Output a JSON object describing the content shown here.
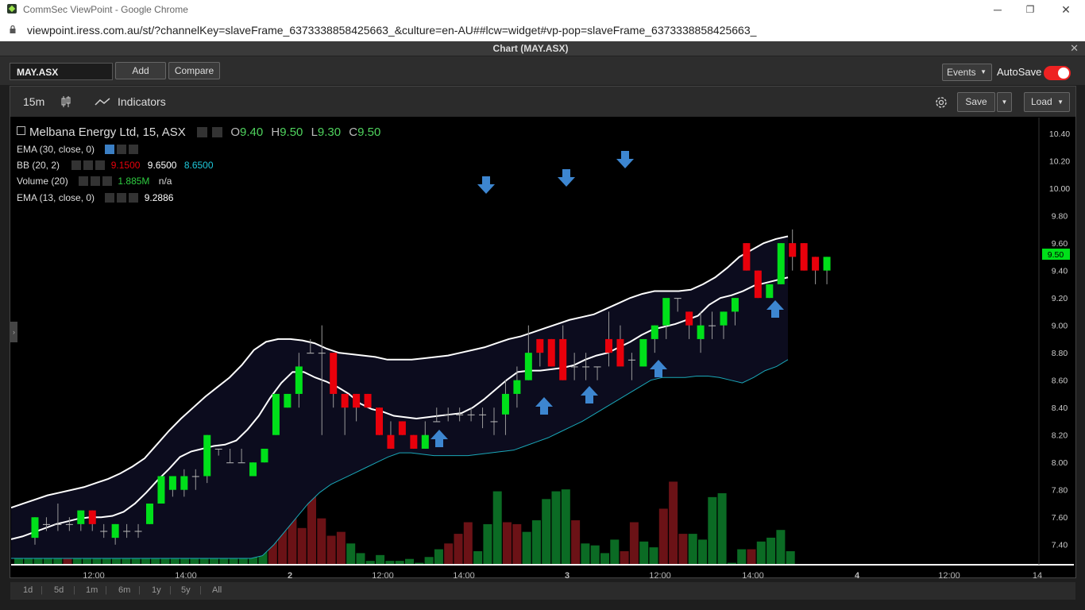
{
  "window": {
    "title": "CommSec ViewPoint - Google Chrome",
    "url": "viewpoint.iress.com.au/st/?channelKey=slaveFrame_6373338858425663_&culture=en-AU##lcw=widget#vp-pop=slaveFrame_6373338858425663_",
    "minimize": "─",
    "restore": "❐",
    "close": "✕"
  },
  "panel": {
    "title": "Chart (MAY.ASX)",
    "close": "✕"
  },
  "toolbar": {
    "symbol": "MAY.ASX",
    "add": "Add",
    "compare": "Compare",
    "events": "Events",
    "autosave": "AutoSave"
  },
  "chart_toolbar": {
    "interval": "15m",
    "indicators": "Indicators",
    "save": "Save",
    "load": "Load"
  },
  "legend": {
    "main": "Melbana Energy Ltd, 15, ASX",
    "o_label": "O",
    "o": "9.40",
    "h_label": "H",
    "h": "9.50",
    "l_label": "L",
    "l": "9.30",
    "c_label": "C",
    "c": "9.50",
    "ema30": "EMA (30, close, 0)",
    "bb": "BB (20, 2)",
    "bb_v1": "9.1500",
    "bb_v2": "9.6500",
    "bb_v3": "8.6500",
    "vol": "Volume (20)",
    "vol_v1": "1.885M",
    "vol_v2": "n/a",
    "ema13": "EMA (13, close, 0)",
    "ema13_v": "9.2886"
  },
  "range_buttons": [
    "1d",
    "5d",
    "1m",
    "6m",
    "1y",
    "5y",
    "All"
  ],
  "colors": {
    "up": "#00e01a",
    "down": "#e8000b",
    "vol_up": "#0b6b24",
    "vol_down": "#6b1216",
    "ema": "#ffffff",
    "bb_lower": "#1aa7b8",
    "price_tag": "#00e01a",
    "arrow": "#3d86d0"
  },
  "chart_data": {
    "type": "candlestick",
    "y_ticks": [
      10.4,
      10.2,
      10.0,
      9.8,
      9.6,
      9.4,
      9.2,
      9.0,
      8.8,
      8.6,
      8.4,
      8.2,
      8.0,
      7.8,
      7.6,
      7.4
    ],
    "ylim": [
      7.3,
      10.47
    ],
    "x_ticks": [
      "12:00",
      "14:00",
      "2",
      "12:00",
      "14:00",
      "3",
      "12:00",
      "14:00",
      "4",
      "12:00",
      "14"
    ],
    "last_price": "9.50",
    "candles": [
      [
        7.45,
        7.6,
        7.4,
        7.6
      ],
      [
        7.55,
        7.6,
        7.5,
        7.55
      ],
      [
        7.55,
        7.7,
        7.5,
        7.55
      ],
      [
        7.55,
        7.6,
        7.5,
        7.55
      ],
      [
        7.55,
        7.65,
        7.5,
        7.65
      ],
      [
        7.65,
        7.65,
        7.5,
        7.55
      ],
      [
        7.5,
        7.55,
        7.45,
        7.5
      ],
      [
        7.45,
        7.55,
        7.4,
        7.55
      ],
      [
        7.5,
        7.55,
        7.45,
        7.5
      ],
      [
        7.5,
        7.55,
        7.45,
        7.5
      ],
      [
        7.55,
        7.7,
        7.55,
        7.7
      ],
      [
        7.7,
        7.9,
        7.7,
        7.9
      ],
      [
        7.8,
        7.9,
        7.75,
        7.9
      ],
      [
        7.8,
        7.95,
        7.75,
        7.9
      ],
      [
        7.9,
        7.95,
        7.8,
        7.9
      ],
      [
        7.9,
        8.2,
        7.85,
        8.2
      ],
      [
        8.1,
        8.1,
        8.05,
        8.1
      ],
      [
        8.0,
        8.1,
        8.0,
        8.0
      ],
      [
        8.0,
        8.1,
        8.0,
        8.0
      ],
      [
        7.9,
        8.0,
        7.9,
        8.0
      ],
      [
        8.0,
        8.1,
        8.0,
        8.1
      ],
      [
        8.2,
        8.5,
        8.2,
        8.5
      ],
      [
        8.4,
        8.5,
        8.4,
        8.5
      ],
      [
        8.5,
        8.8,
        8.4,
        8.7
      ],
      [
        8.8,
        8.9,
        8.8,
        8.8
      ],
      [
        8.8,
        9.0,
        8.2,
        8.8
      ],
      [
        8.8,
        8.8,
        8.4,
        8.5
      ],
      [
        8.5,
        8.5,
        8.2,
        8.4
      ],
      [
        8.5,
        8.5,
        8.3,
        8.4
      ],
      [
        8.5,
        8.5,
        8.4,
        8.4
      ],
      [
        8.4,
        8.4,
        8.2,
        8.2
      ],
      [
        8.2,
        8.3,
        8.1,
        8.1
      ],
      [
        8.3,
        8.3,
        8.2,
        8.2
      ],
      [
        8.2,
        8.2,
        8.1,
        8.1
      ],
      [
        8.1,
        8.3,
        8.1,
        8.2
      ],
      [
        8.3,
        8.4,
        8.3,
        8.3
      ],
      [
        8.35,
        8.4,
        8.3,
        8.35
      ],
      [
        8.35,
        8.4,
        8.3,
        8.35
      ],
      [
        8.35,
        8.4,
        8.3,
        8.35
      ],
      [
        8.35,
        8.4,
        8.25,
        8.35
      ],
      [
        8.3,
        8.4,
        8.2,
        8.3
      ],
      [
        8.35,
        8.6,
        8.2,
        8.5
      ],
      [
        8.5,
        8.7,
        8.4,
        8.6
      ],
      [
        8.6,
        9.0,
        8.6,
        8.8
      ],
      [
        8.9,
        8.9,
        8.7,
        8.8
      ],
      [
        8.9,
        8.9,
        8.7,
        8.7
      ],
      [
        8.9,
        9.0,
        8.6,
        8.6
      ],
      [
        8.7,
        8.8,
        8.6,
        8.7
      ],
      [
        8.7,
        8.8,
        8.6,
        8.7
      ],
      [
        8.7,
        8.7,
        8.6,
        8.7
      ],
      [
        8.9,
        9.1,
        8.7,
        8.8
      ],
      [
        8.9,
        9.0,
        8.8,
        8.7
      ],
      [
        8.75,
        8.8,
        8.6,
        8.75
      ],
      [
        8.7,
        8.9,
        8.7,
        8.9
      ],
      [
        8.9,
        9.0,
        8.8,
        9.0
      ],
      [
        9.0,
        9.1,
        8.9,
        9.2
      ],
      [
        9.2,
        9.2,
        9.1,
        9.2
      ],
      [
        9.1,
        9.1,
        8.9,
        9.0
      ],
      [
        8.9,
        9.1,
        8.8,
        9.0
      ],
      [
        9.0,
        9.1,
        8.9,
        9.0
      ],
      [
        9.0,
        9.1,
        8.9,
        9.1
      ],
      [
        9.1,
        9.2,
        9.0,
        9.2
      ],
      [
        9.6,
        9.6,
        9.4,
        9.4
      ],
      [
        9.4,
        9.4,
        9.2,
        9.2
      ],
      [
        9.2,
        9.3,
        9.2,
        9.3
      ],
      [
        9.3,
        9.6,
        9.3,
        9.6
      ],
      [
        9.6,
        9.7,
        9.4,
        9.5
      ],
      [
        9.6,
        9.6,
        9.4,
        9.4
      ],
      [
        9.5,
        9.5,
        9.3,
        9.4
      ],
      [
        9.4,
        9.5,
        9.3,
        9.5
      ]
    ],
    "volume_rel": [
      0.21,
      0.27,
      0.13,
      0.08,
      0.09,
      0.06,
      0.05,
      0.04,
      0.04,
      0.06,
      0.08,
      0.16,
      0.41,
      0.35,
      0.19,
      0.2,
      0.5,
      0.05,
      0.04,
      0.04,
      0.06,
      0.06,
      0.11,
      0.27,
      0.35,
      0.52,
      0.41,
      0.31,
      0.74,
      0.19,
      0.4,
      0.24,
      0.15,
      0.17,
      0.11,
      0.06,
      0.02,
      0.05,
      0.02,
      0.02,
      0.03,
      0.01,
      0.04,
      0.08,
      0.11,
      0.16,
      0.22,
      0.07,
      0.21,
      0.38,
      0.22,
      0.21,
      0.17,
      0.23,
      0.34,
      0.38,
      0.39,
      0.23,
      0.11,
      0.1,
      0.06,
      0.13,
      0.07,
      0.22,
      0.12,
      0.09,
      0.29,
      0.43,
      0.16,
      0.16,
      0.13,
      0.35,
      0.37,
      0.01,
      0.08,
      0.08,
      0.12,
      0.14,
      0.18,
      0.07
    ],
    "ema13": [
      7.44,
      7.46,
      7.49,
      7.52,
      7.55,
      7.57,
      7.59,
      7.6,
      7.6,
      7.61,
      7.64,
      7.7,
      7.78,
      7.87,
      7.95,
      8.04,
      8.08,
      8.1,
      8.12,
      8.13,
      8.16,
      8.24,
      8.34,
      8.47,
      8.58,
      8.66,
      8.66,
      8.62,
      8.59,
      8.55,
      8.5,
      8.43,
      8.39,
      8.37,
      8.34,
      8.33,
      8.32,
      8.33,
      8.34,
      8.35,
      8.36,
      8.4,
      8.46,
      8.53,
      8.6,
      8.66,
      8.67,
      8.67,
      8.68,
      8.69,
      8.71,
      8.75,
      8.78,
      8.8,
      8.84,
      8.88,
      8.93,
      8.97,
      8.99,
      9.01,
      9.04,
      9.07,
      9.15,
      9.2,
      9.22,
      9.25,
      9.29,
      9.31,
      9.33,
      9.35
    ],
    "bb_upper": [
      7.67,
      7.7,
      7.73,
      7.76,
      7.78,
      7.8,
      7.82,
      7.85,
      7.88,
      7.92,
      7.97,
      8.03,
      8.13,
      8.23,
      8.32,
      8.4,
      8.48,
      8.55,
      8.62,
      8.71,
      8.82,
      8.88,
      8.9,
      8.9,
      8.89,
      8.87,
      8.83,
      8.8,
      8.79,
      8.78,
      8.77,
      8.75,
      8.75,
      8.75,
      8.76,
      8.77,
      8.78,
      8.8,
      8.82,
      8.84,
      8.87,
      8.9,
      8.92,
      8.95,
      8.98,
      9.01,
      9.04,
      9.06,
      9.08,
      9.12,
      9.16,
      9.2,
      9.23,
      9.25,
      9.25,
      9.25,
      9.26,
      9.3,
      9.35,
      9.42,
      9.5,
      9.55,
      9.6,
      9.63,
      9.65
    ],
    "bb_lower": [
      7.3,
      7.3,
      7.3,
      7.3,
      7.3,
      7.3,
      7.3,
      7.3,
      7.3,
      7.3,
      7.3,
      7.3,
      7.3,
      7.3,
      7.3,
      7.3,
      7.3,
      7.3,
      7.3,
      7.3,
      7.3,
      7.3,
      7.32,
      7.4,
      7.5,
      7.6,
      7.7,
      7.78,
      7.84,
      7.88,
      7.92,
      7.96,
      8.0,
      8.04,
      8.07,
      8.07,
      8.06,
      8.05,
      8.05,
      8.05,
      8.05,
      8.06,
      8.07,
      8.08,
      8.09,
      8.12,
      8.15,
      8.18,
      8.22,
      8.26,
      8.3,
      8.35,
      8.4,
      8.45,
      8.5,
      8.55,
      8.6,
      8.62,
      8.62,
      8.62,
      8.63,
      8.63,
      8.62,
      8.6,
      8.58,
      8.62,
      8.67,
      8.7,
      8.75
    ]
  }
}
